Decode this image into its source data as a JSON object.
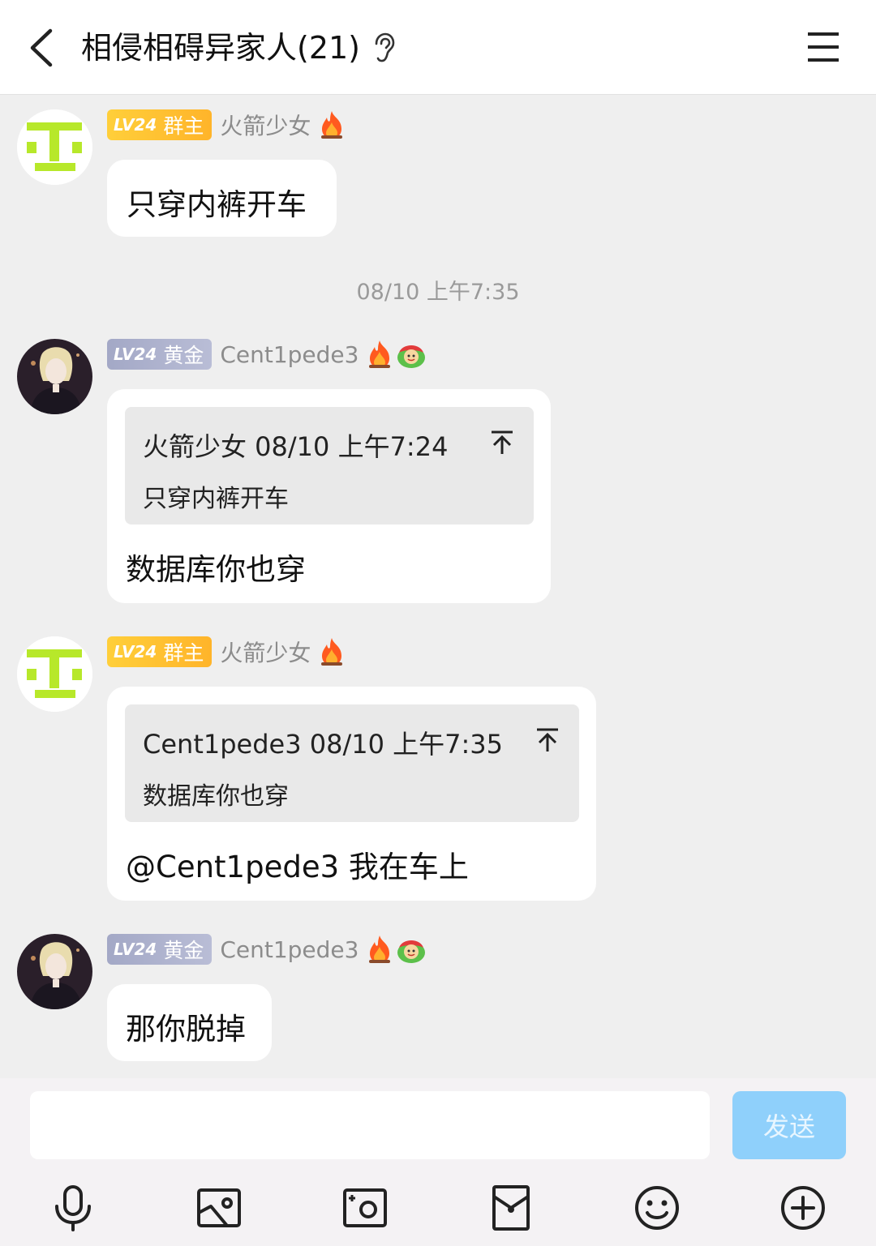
{
  "header": {
    "title": "相侵相碍异家人(21)"
  },
  "messages": [
    {
      "badge_level": "LV24",
      "badge_role": "群主",
      "nickname": "火箭少女",
      "text": "只穿内裤开车"
    },
    {
      "badge_level": "LV24",
      "badge_role": "黄金",
      "nickname": "Cent1pede3",
      "quote_head": "火箭少女 08/10 上午7:24",
      "quote_body": "只穿内裤开车",
      "text": "数据库你也穿"
    },
    {
      "badge_level": "LV24",
      "badge_role": "群主",
      "nickname": "火箭少女",
      "quote_head": "Cent1pede3 08/10 上午7:35",
      "quote_body": "数据库你也穿",
      "text": "@Cent1pede3 我在车上"
    },
    {
      "badge_level": "LV24",
      "badge_role": "黄金",
      "nickname": "Cent1pede3",
      "text": "那你脱掉"
    }
  ],
  "time_divider": "08/10 上午7:35",
  "input": {
    "value": "",
    "send_label": "发送"
  },
  "toolbar": [
    "microphone-icon",
    "image-icon",
    "camera-icon",
    "red-packet-icon",
    "emoji-icon",
    "plus-icon"
  ],
  "colors": {
    "owner_badge": "#ffc12f",
    "gold_badge": "#a9aecb",
    "send_button": "#8fd0fb",
    "background": "#efefef"
  }
}
